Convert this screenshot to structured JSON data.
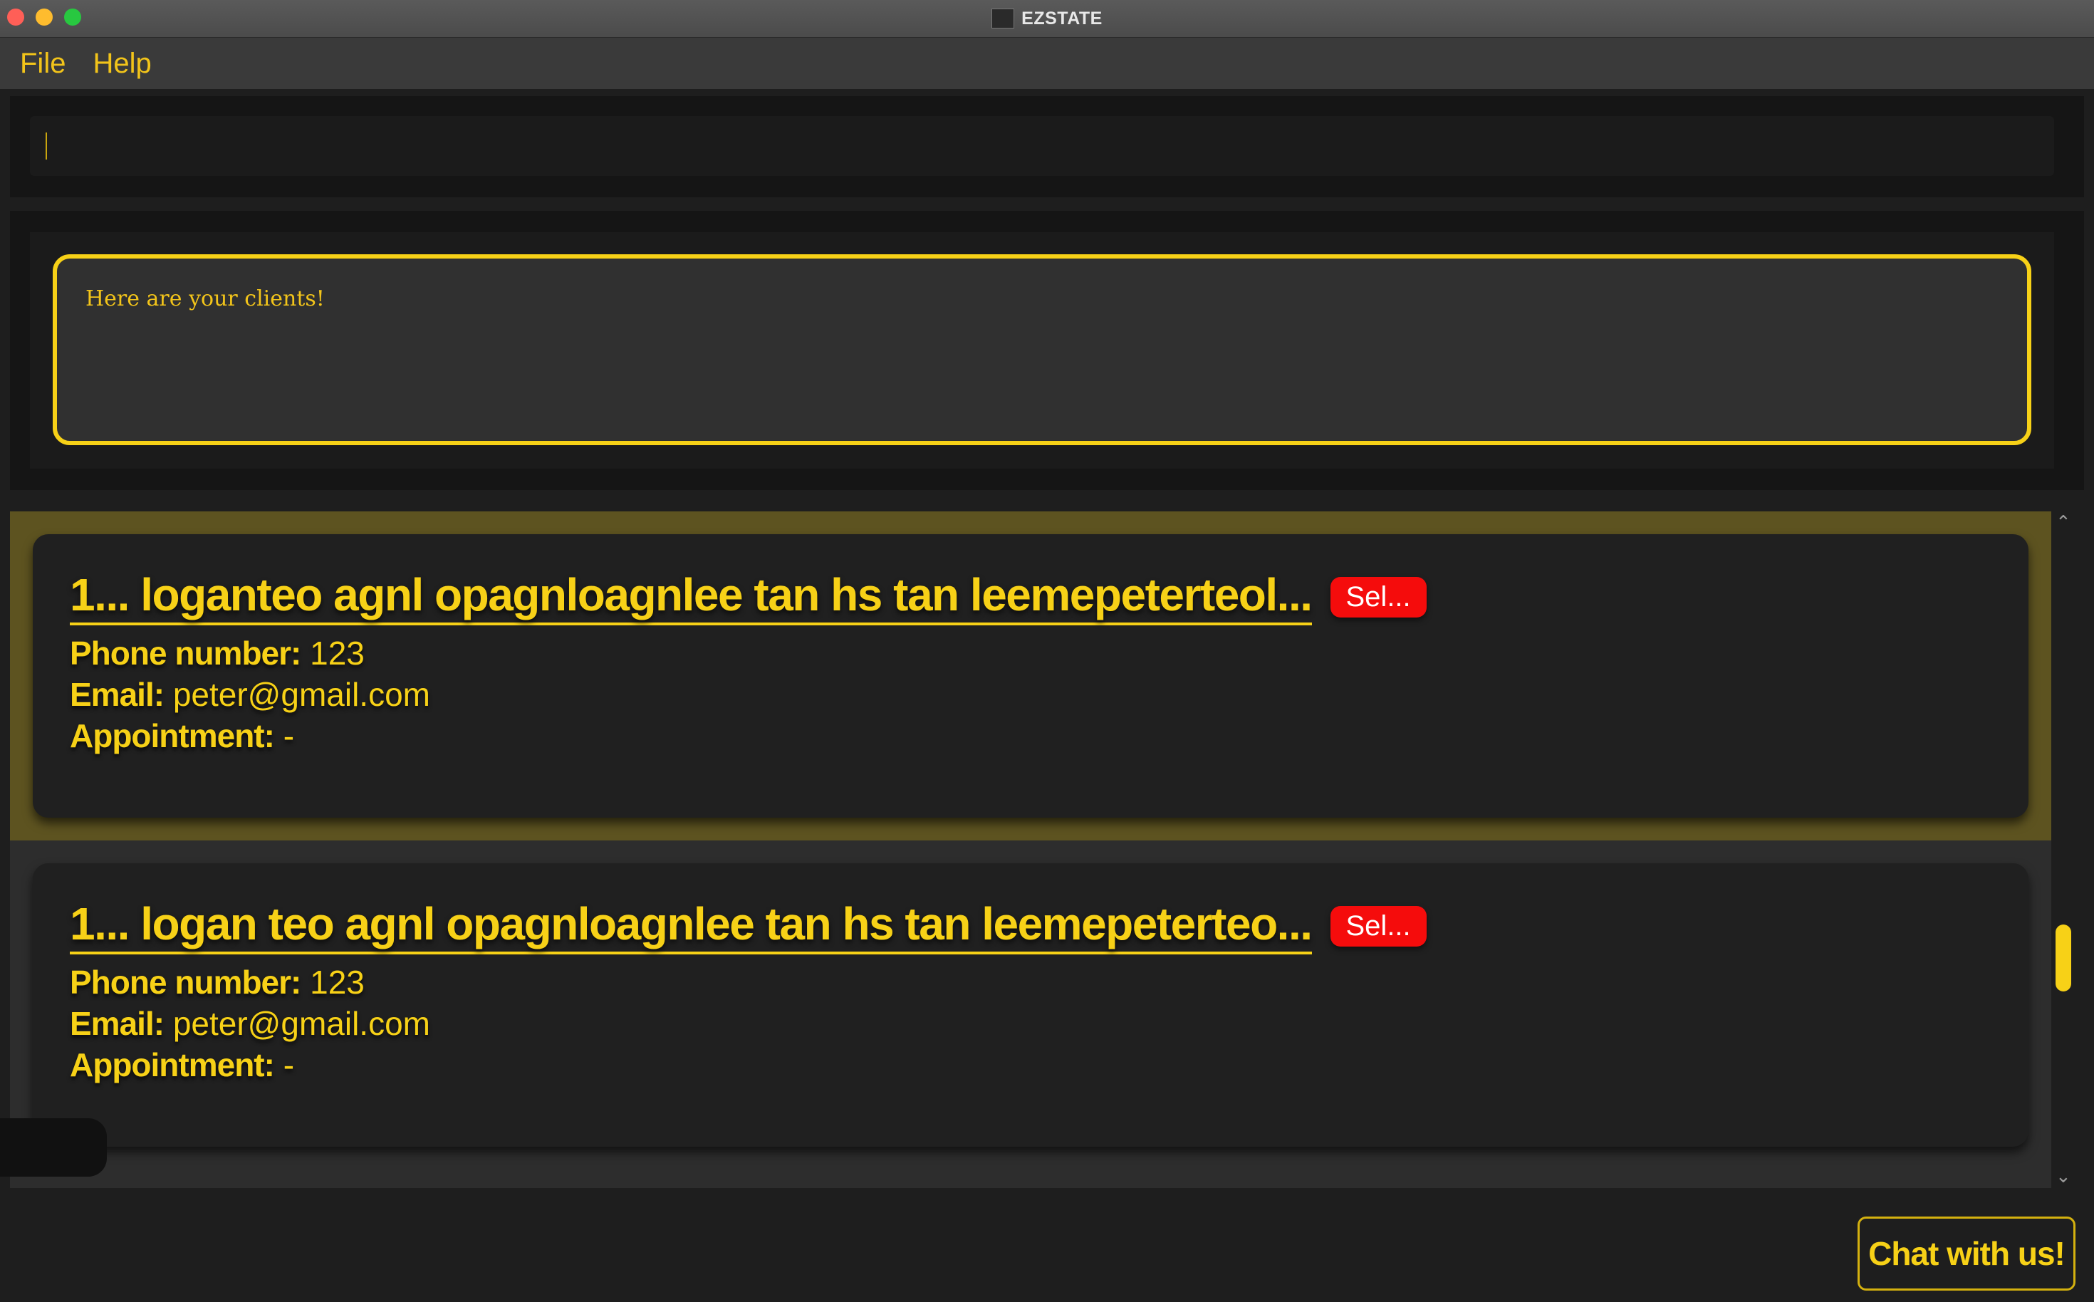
{
  "window": {
    "title": "EZSTATE"
  },
  "menu": {
    "items": [
      "File",
      "Help"
    ]
  },
  "command": {
    "value": ""
  },
  "result": {
    "message": "Here are your clients!"
  },
  "clients": [
    {
      "name": "1...  loganteo agnl opagnloagnlee tan hs tan leemepeterteol...",
      "tag": "Sel...",
      "phone_label": "Phone number:",
      "phone": "123",
      "email_label": "Email:",
      "email": "peter@gmail.com",
      "appointment_label": "Appointment:",
      "appointment": "-",
      "selected": true
    },
    {
      "name": "1...  logan teo agnl opagnloagnlee tan hs tan leemepeterteo...",
      "tag": "Sel...",
      "phone_label": "Phone number:",
      "phone": "123",
      "email_label": "Email:",
      "email": "peter@gmail.com",
      "appointment_label": "Appointment:",
      "appointment": "-",
      "selected": false
    }
  ],
  "chat": {
    "label": "Chat with us!"
  },
  "colors": {
    "accent": "#f7d117",
    "tag": "#f50c0c",
    "background": "#1e1e1e",
    "selected_row": "#5d5320"
  },
  "icons": {
    "scroll_up": "chevron-up-icon",
    "scroll_down": "chevron-down-icon"
  }
}
